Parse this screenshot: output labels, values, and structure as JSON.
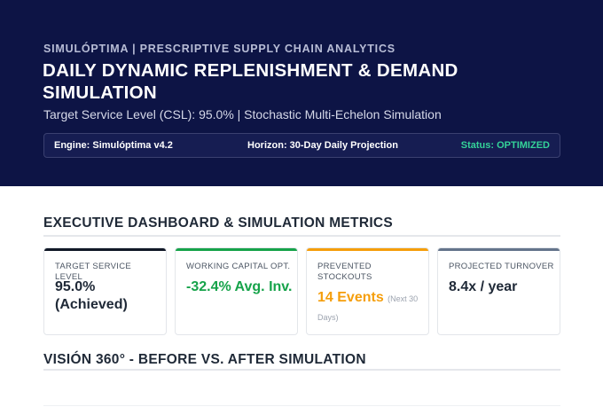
{
  "header": {
    "kicker": "SIMULÓPTIMA | PRESCRIPTIVE SUPPLY CHAIN ANALYTICS",
    "title": "DAILY DYNAMIC REPLENISHMENT & DEMAND SIMULATION",
    "subtitle": "Target Service Level (CSL): 95.0% | Stochastic Multi-Echelon Simulation",
    "status_bar": {
      "engine": "Engine: Simulóptima v4.2",
      "horizon": "Horizon: 30-Day Daily Projection",
      "status": "Status: OPTIMIZED"
    }
  },
  "dashboard": {
    "title": "EXECUTIVE DASHBOARD & SIMULATION METRICS",
    "cards": [
      {
        "label": "TARGET SERVICE LEVEL",
        "value": "95.0% (Achieved)",
        "note": "",
        "accent": "#111827"
      },
      {
        "label": "WORKING CAPITAL OPT.",
        "value": "-32.4% Avg. Inv.",
        "note": "",
        "accent": "#16a34a"
      },
      {
        "label": "PREVENTED STOCKOUTS",
        "value": "14 Events",
        "note": "(Next 30 Days)",
        "accent": "#f59e0b"
      },
      {
        "label": "PROJECTED TURNOVER",
        "value": "8.4x / year",
        "note": "",
        "accent": "#64748b"
      }
    ]
  },
  "vision": {
    "title": "VISIÓN 360° - BEFORE VS. AFTER SIMULATION"
  },
  "colors": {
    "hero_bg": "#0d1445",
    "status_ok": "#34d399"
  }
}
